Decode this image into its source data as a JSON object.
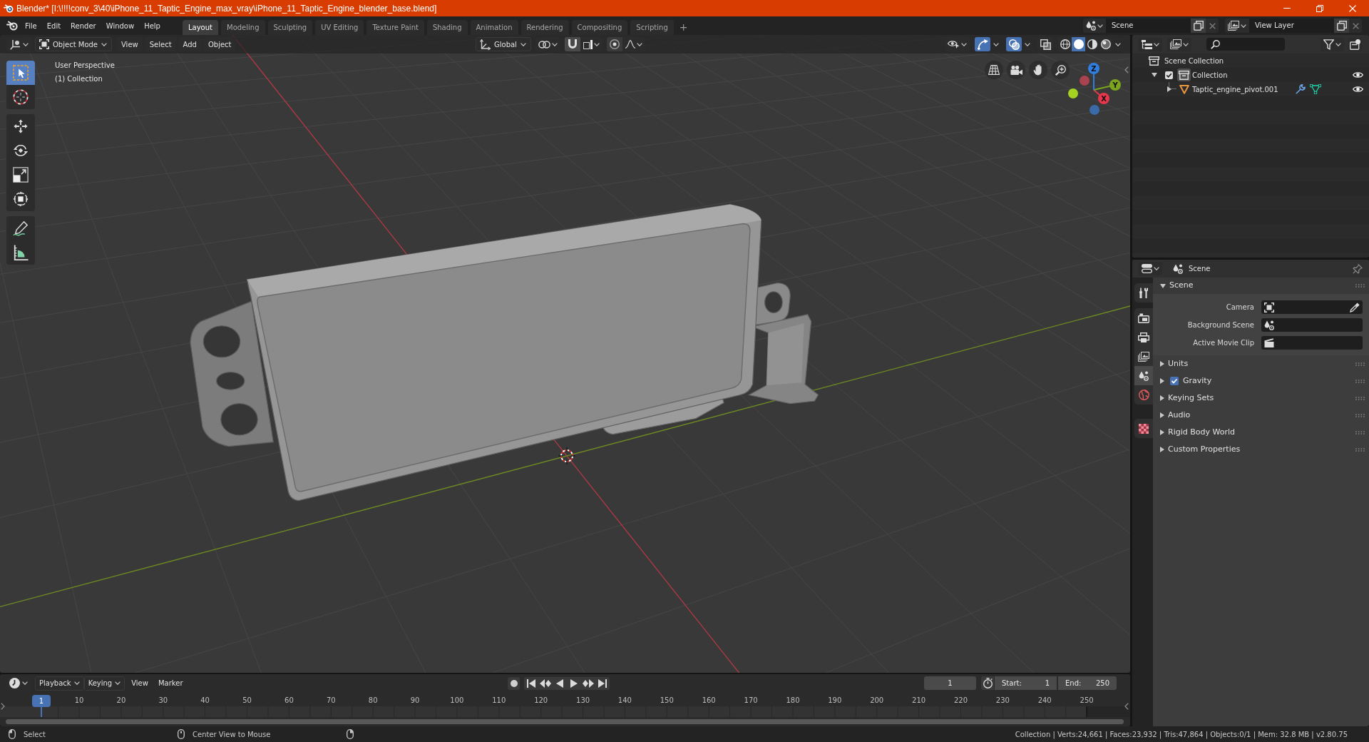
{
  "window": {
    "title": "Blender* [I:\\!!!!conv_3\\40\\iPhone_11_Taptic_Engine_max_vray\\iPhone_11_Taptic_Engine_blender_base.blend]"
  },
  "menu": [
    "File",
    "Edit",
    "Render",
    "Window",
    "Help"
  ],
  "workspaces": [
    {
      "label": "Layout",
      "selected": true
    },
    {
      "label": "Modeling",
      "selected": false
    },
    {
      "label": "Sculpting",
      "selected": false
    },
    {
      "label": "UV Editing",
      "selected": false
    },
    {
      "label": "Texture Paint",
      "selected": false
    },
    {
      "label": "Shading",
      "selected": false
    },
    {
      "label": "Animation",
      "selected": false
    },
    {
      "label": "Rendering",
      "selected": false
    },
    {
      "label": "Compositing",
      "selected": false
    },
    {
      "label": "Scripting",
      "selected": false
    }
  ],
  "add_workspace": "+",
  "scene": "Scene",
  "view_layer": "View Layer",
  "viewport": {
    "header": {
      "mode": "Object Mode",
      "menus": [
        "View",
        "Select",
        "Add",
        "Object"
      ],
      "orientation": "Global",
      "snap": false,
      "proportional_editing": false,
      "toggles": [
        {
          "kind": "gizmos",
          "on": true
        },
        {
          "kind": "overlays",
          "on": true
        },
        {
          "kind": "xray",
          "on": false
        }
      ],
      "shading": [
        {
          "kind": "wireframe",
          "selected": false
        },
        {
          "kind": "solid",
          "selected": true
        },
        {
          "kind": "material",
          "selected": false
        },
        {
          "kind": "rendered",
          "selected": false
        }
      ]
    },
    "tools": [
      [
        {
          "kind": "select_box",
          "selected": true
        },
        {
          "kind": "cursor",
          "selected": false
        }
      ],
      [
        {
          "kind": "move",
          "selected": false
        },
        {
          "kind": "rotate",
          "selected": false
        },
        {
          "kind": "scale",
          "selected": false
        },
        {
          "kind": "transform",
          "selected": false
        }
      ],
      [
        {
          "kind": "annotate",
          "selected": false
        },
        {
          "kind": "measure",
          "selected": false
        }
      ]
    ],
    "overlay_text": [
      "User Perspective",
      "(1) Collection"
    ],
    "gizmo_axes": [
      {
        "kind": "x",
        "label": "X"
      },
      {
        "kind": "y",
        "label": "Y"
      },
      {
        "kind": "z",
        "label": "Z"
      }
    ]
  },
  "outliner": {
    "tree": [
      {
        "label": "Scene Collection",
        "kind": "scene_collection",
        "active": false,
        "children": [
          {
            "label": "Collection",
            "kind": "collection",
            "active": true,
            "expanded": true,
            "checked": true,
            "visible": true,
            "children": [
              {
                "label": "Taptic_engine_pivot.001",
                "kind": "mesh",
                "active": false,
                "expanded": false,
                "visible": true
              }
            ]
          }
        ]
      }
    ]
  },
  "properties": {
    "context": "Scene",
    "tab_groups": [
      [
        {
          "kind": "tool",
          "selected": false
        }
      ],
      [
        {
          "kind": "render",
          "selected": false
        },
        {
          "kind": "output",
          "selected": false
        },
        {
          "kind": "view_layer",
          "selected": false
        },
        {
          "kind": "scene",
          "selected": true
        },
        {
          "kind": "world",
          "selected": false
        }
      ],
      [
        {
          "kind": "texture",
          "selected": false
        }
      ]
    ],
    "panel": {
      "title": "Scene",
      "expanded": true,
      "fields": [
        {
          "label": "Camera",
          "kind": "camera"
        },
        {
          "label": "Background Scene",
          "kind": "scene"
        },
        {
          "label": "Active Movie Clip",
          "kind": "movie_clip"
        }
      ]
    },
    "subpanels": [
      {
        "label": "Units",
        "kind": "plain",
        "expanded": false
      },
      {
        "label": "Gravity",
        "kind": "toggle",
        "expanded": false,
        "checked": true
      },
      {
        "label": "Keying Sets",
        "kind": "plain",
        "expanded": false
      },
      {
        "label": "Audio",
        "kind": "plain",
        "expanded": false
      },
      {
        "label": "Rigid Body World",
        "kind": "plain",
        "expanded": false
      },
      {
        "label": "Custom Properties",
        "kind": "plain",
        "expanded": false
      }
    ]
  },
  "timeline": {
    "menus": [
      {
        "label": "Playback",
        "kind": "dropdown"
      },
      {
        "label": "Keying",
        "kind": "dropdown"
      },
      {
        "label": "View",
        "kind": "menu"
      },
      {
        "label": "Marker",
        "kind": "menu"
      }
    ],
    "auto_keying": false,
    "current_frame": "1",
    "start_label": "Start:",
    "start": "1",
    "end_label": "End:",
    "end": "250",
    "playhead": "1",
    "ruler": [
      "10",
      "20",
      "30",
      "40",
      "50",
      "60",
      "70",
      "80",
      "90",
      "100",
      "110",
      "120",
      "130",
      "140",
      "150",
      "160",
      "170",
      "180",
      "190",
      "200",
      "210",
      "220",
      "230",
      "240",
      "250"
    ]
  },
  "status_bar": {
    "hints": [
      {
        "kind": "left_mouse",
        "label": "Select"
      },
      {
        "kind": "middle_mouse",
        "label": "Center View to Mouse"
      },
      {
        "kind": "right_mouse"
      }
    ],
    "stats": "Collection | Verts:24,661 | Faces:23,932 | Tris:47,864 | Objects:0/1 | Mem: 32.8 MB | v2.80.75"
  }
}
